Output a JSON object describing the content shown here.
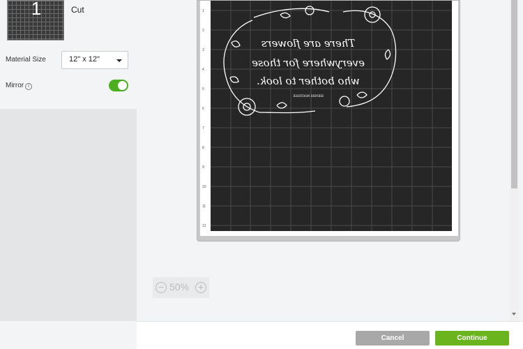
{
  "mat": {
    "number": "1",
    "label": "Cut"
  },
  "material_size": {
    "label": "Material Size",
    "value": "12\" x 12\""
  },
  "mirror": {
    "label": "Mirror",
    "enabled": true,
    "info_icon": "info-icon"
  },
  "canvas": {
    "ruler_numbers": [
      "1",
      "2",
      "3",
      "4",
      "5",
      "6",
      "7",
      "8",
      "9",
      "10",
      "11",
      "12"
    ],
    "design_text_lines": [
      "There are flowers",
      "everywhere for those",
      "who bother to look."
    ],
    "design_attribution": "HENRI MATISSE"
  },
  "zoom": {
    "out_icon": "zoom-out-icon",
    "level": "50%",
    "in_icon": "zoom-in-icon"
  },
  "footer": {
    "cancel_label": "Cancel",
    "continue_label": "Continue"
  },
  "colors": {
    "toggle_on": "#4caf1f",
    "continue": "#6ab51e",
    "cancel": "#a8a8a8",
    "mat": "#262626"
  }
}
